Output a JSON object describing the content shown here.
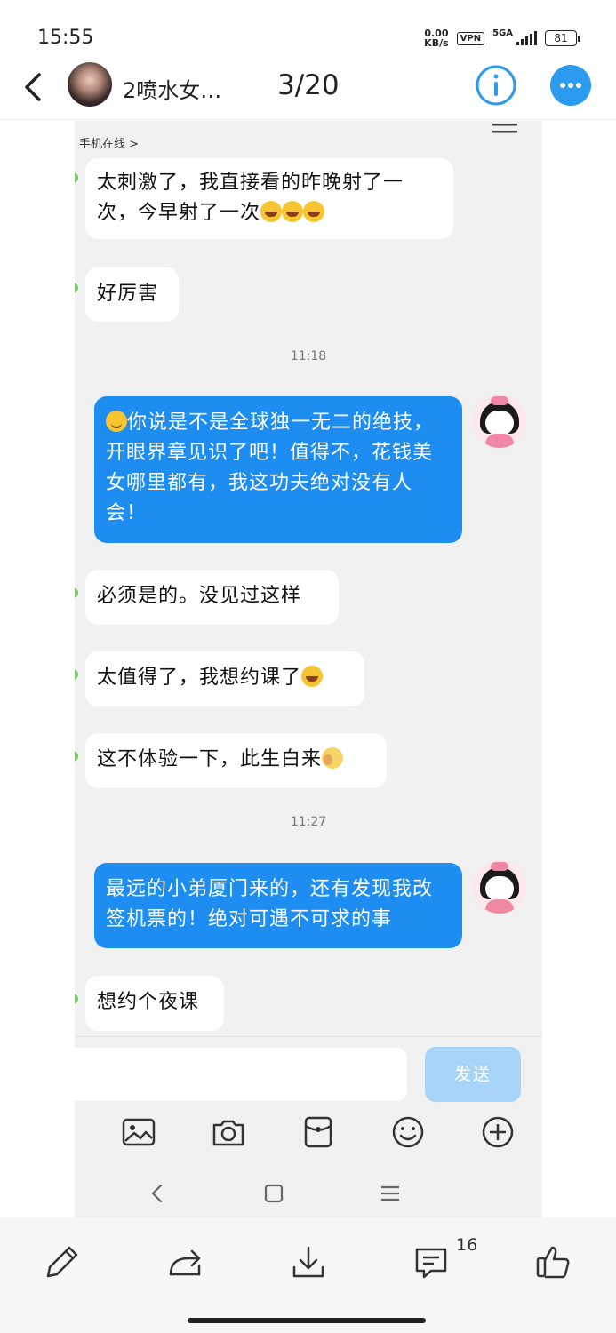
{
  "status_bar": {
    "time": "15:55",
    "net_speed_value": "0.00",
    "net_speed_unit": "KB/s",
    "vpn": "VPN",
    "network": "5GA",
    "battery": "81"
  },
  "header": {
    "title": "2喷水女…",
    "page_counter": "3/20"
  },
  "chat": {
    "online_status": "手机在线 >",
    "messages": [
      {
        "side": "left",
        "text": "太刺激了，我直接看的昨晚射了一次，今早射了一次",
        "emojis": [
          "laugh",
          "laugh",
          "laugh"
        ]
      },
      {
        "side": "left",
        "text": "好厉害"
      },
      {
        "side": "time",
        "text": "11:18"
      },
      {
        "side": "right",
        "text": "你说是不是全球独一无二的绝技，开眼界章见识了吧！值得不，花钱美女哪里都有，我这功夫绝对没有人会！",
        "emojis": [
          "smile"
        ]
      },
      {
        "side": "left",
        "text": "必须是的。没见过这样"
      },
      {
        "side": "left",
        "text": "太值得了，我想约课了",
        "emojis": [
          "laugh"
        ]
      },
      {
        "side": "left",
        "text": "这不体验一下，此生白来",
        "emojis": [
          "cover"
        ]
      },
      {
        "side": "time",
        "text": "11:27"
      },
      {
        "side": "right",
        "text": "最远的小弟厦门来的，还有发现我改签机票的！绝对可遇不可求的事"
      },
      {
        "side": "left",
        "text": "想约个夜课"
      }
    ],
    "send_label": "发送"
  },
  "action_bar": {
    "comment_count": "16"
  },
  "colors": {
    "accent": "#2a9bee",
    "bubble_right": "#1d8df2",
    "send_disabled": "#a8d4f7"
  }
}
